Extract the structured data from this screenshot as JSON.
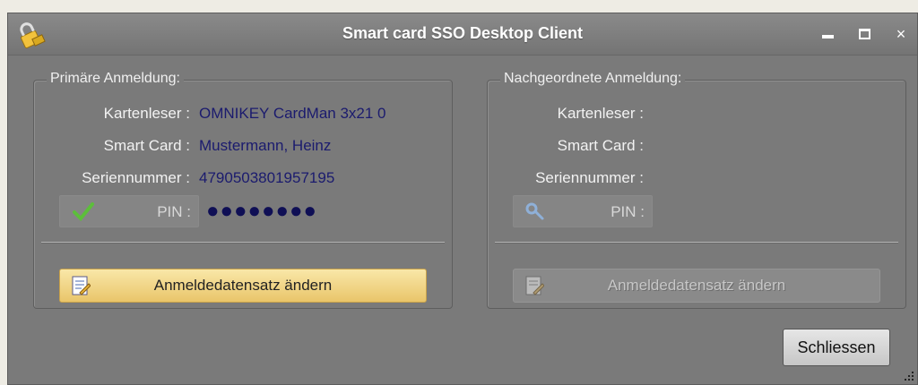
{
  "window": {
    "title": "Smart card SSO Desktop Client",
    "controls": {
      "minimize": "minimize",
      "maximize": "maximize",
      "close": "×"
    }
  },
  "primary": {
    "legend": "Primäre Anmeldung:",
    "card_reader_label": "Kartenleser :",
    "card_reader_value": "OMNIKEY CardMan 3x21 0",
    "smart_card_label": "Smart Card :",
    "smart_card_value": "Mustermann, Heinz",
    "serial_label": "Seriennummer :",
    "serial_value": "4790503801957195",
    "pin_label": "PIN :",
    "pin_value": "●●●●●●●●",
    "pin_status_icon": "checkmark-icon",
    "action_label": "Anmeldedatensatz ändern"
  },
  "secondary": {
    "legend": "Nachgeordnete Anmeldung:",
    "card_reader_label": "Kartenleser :",
    "smart_card_label": "Smart Card :",
    "serial_label": "Seriennummer :",
    "pin_label": "PIN :",
    "pin_status_icon": "key-icon",
    "action_label": "Anmeldedatensatz ändern"
  },
  "footer": {
    "close_label": "Schliessen"
  },
  "colors": {
    "window_bg": "#7a7a7a",
    "value_text": "#1b1b6e",
    "active_button": "#f3d98a",
    "success": "#5cbf3a"
  }
}
